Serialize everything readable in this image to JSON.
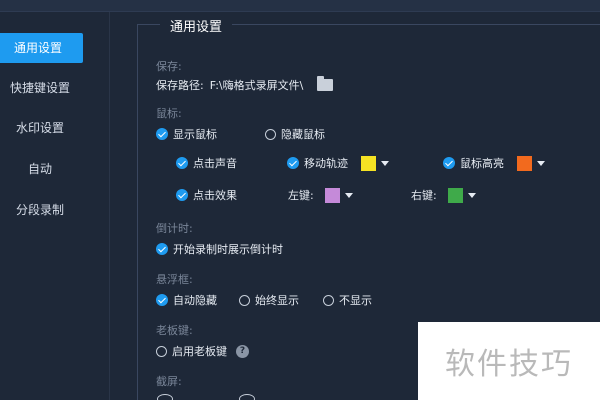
{
  "sidebar": {
    "items": [
      {
        "label": "通用设置",
        "active": true
      },
      {
        "label": "快捷键设置",
        "active": false
      },
      {
        "label": "水印设置",
        "active": false
      },
      {
        "label": "自动",
        "active": false
      },
      {
        "label": "分段录制",
        "active": false
      }
    ]
  },
  "section": {
    "title": "通用设置"
  },
  "save": {
    "group": "保存:",
    "path_label": "保存路径:",
    "path_value": "F:\\嗨格式录屏文件\\",
    "folder_icon": "folder-icon"
  },
  "mouse": {
    "group": "鼠标:",
    "show": {
      "label": "显示鼠标",
      "checked": true
    },
    "hide": {
      "label": "隐藏鼠标",
      "checked": false
    },
    "click_sound": {
      "label": "点击声音",
      "checked": true
    },
    "trail": {
      "label": "移动轨迹",
      "checked": true,
      "color": "#f5e223"
    },
    "highlight": {
      "label": "鼠标高亮",
      "checked": true,
      "color": "#f26a1e"
    },
    "click_effect": {
      "label": "点击效果",
      "checked": true
    },
    "left_key": {
      "label": "左键:",
      "color": "#c58ad9"
    },
    "right_key": {
      "label": "右键:",
      "color": "#3faa4a"
    }
  },
  "countdown": {
    "group": "倒计时:",
    "show_countdown": {
      "label": "开始录制时展示倒计时",
      "checked": true
    }
  },
  "float": {
    "group": "悬浮框:",
    "auto_hide": {
      "label": "自动隐藏",
      "checked": true
    },
    "always_show": {
      "label": "始终显示",
      "checked": false
    },
    "no_show": {
      "label": "不显示",
      "checked": false
    }
  },
  "boss_key": {
    "group": "老板键:",
    "enable": {
      "label": "启用老板键",
      "checked": false
    },
    "help_icon": "?"
  },
  "screenshot": {
    "group": "截屏:"
  },
  "watermark": {
    "text": "软件技巧"
  },
  "colors": {
    "accent": "#1e9bf0",
    "background": "#1e2838"
  }
}
